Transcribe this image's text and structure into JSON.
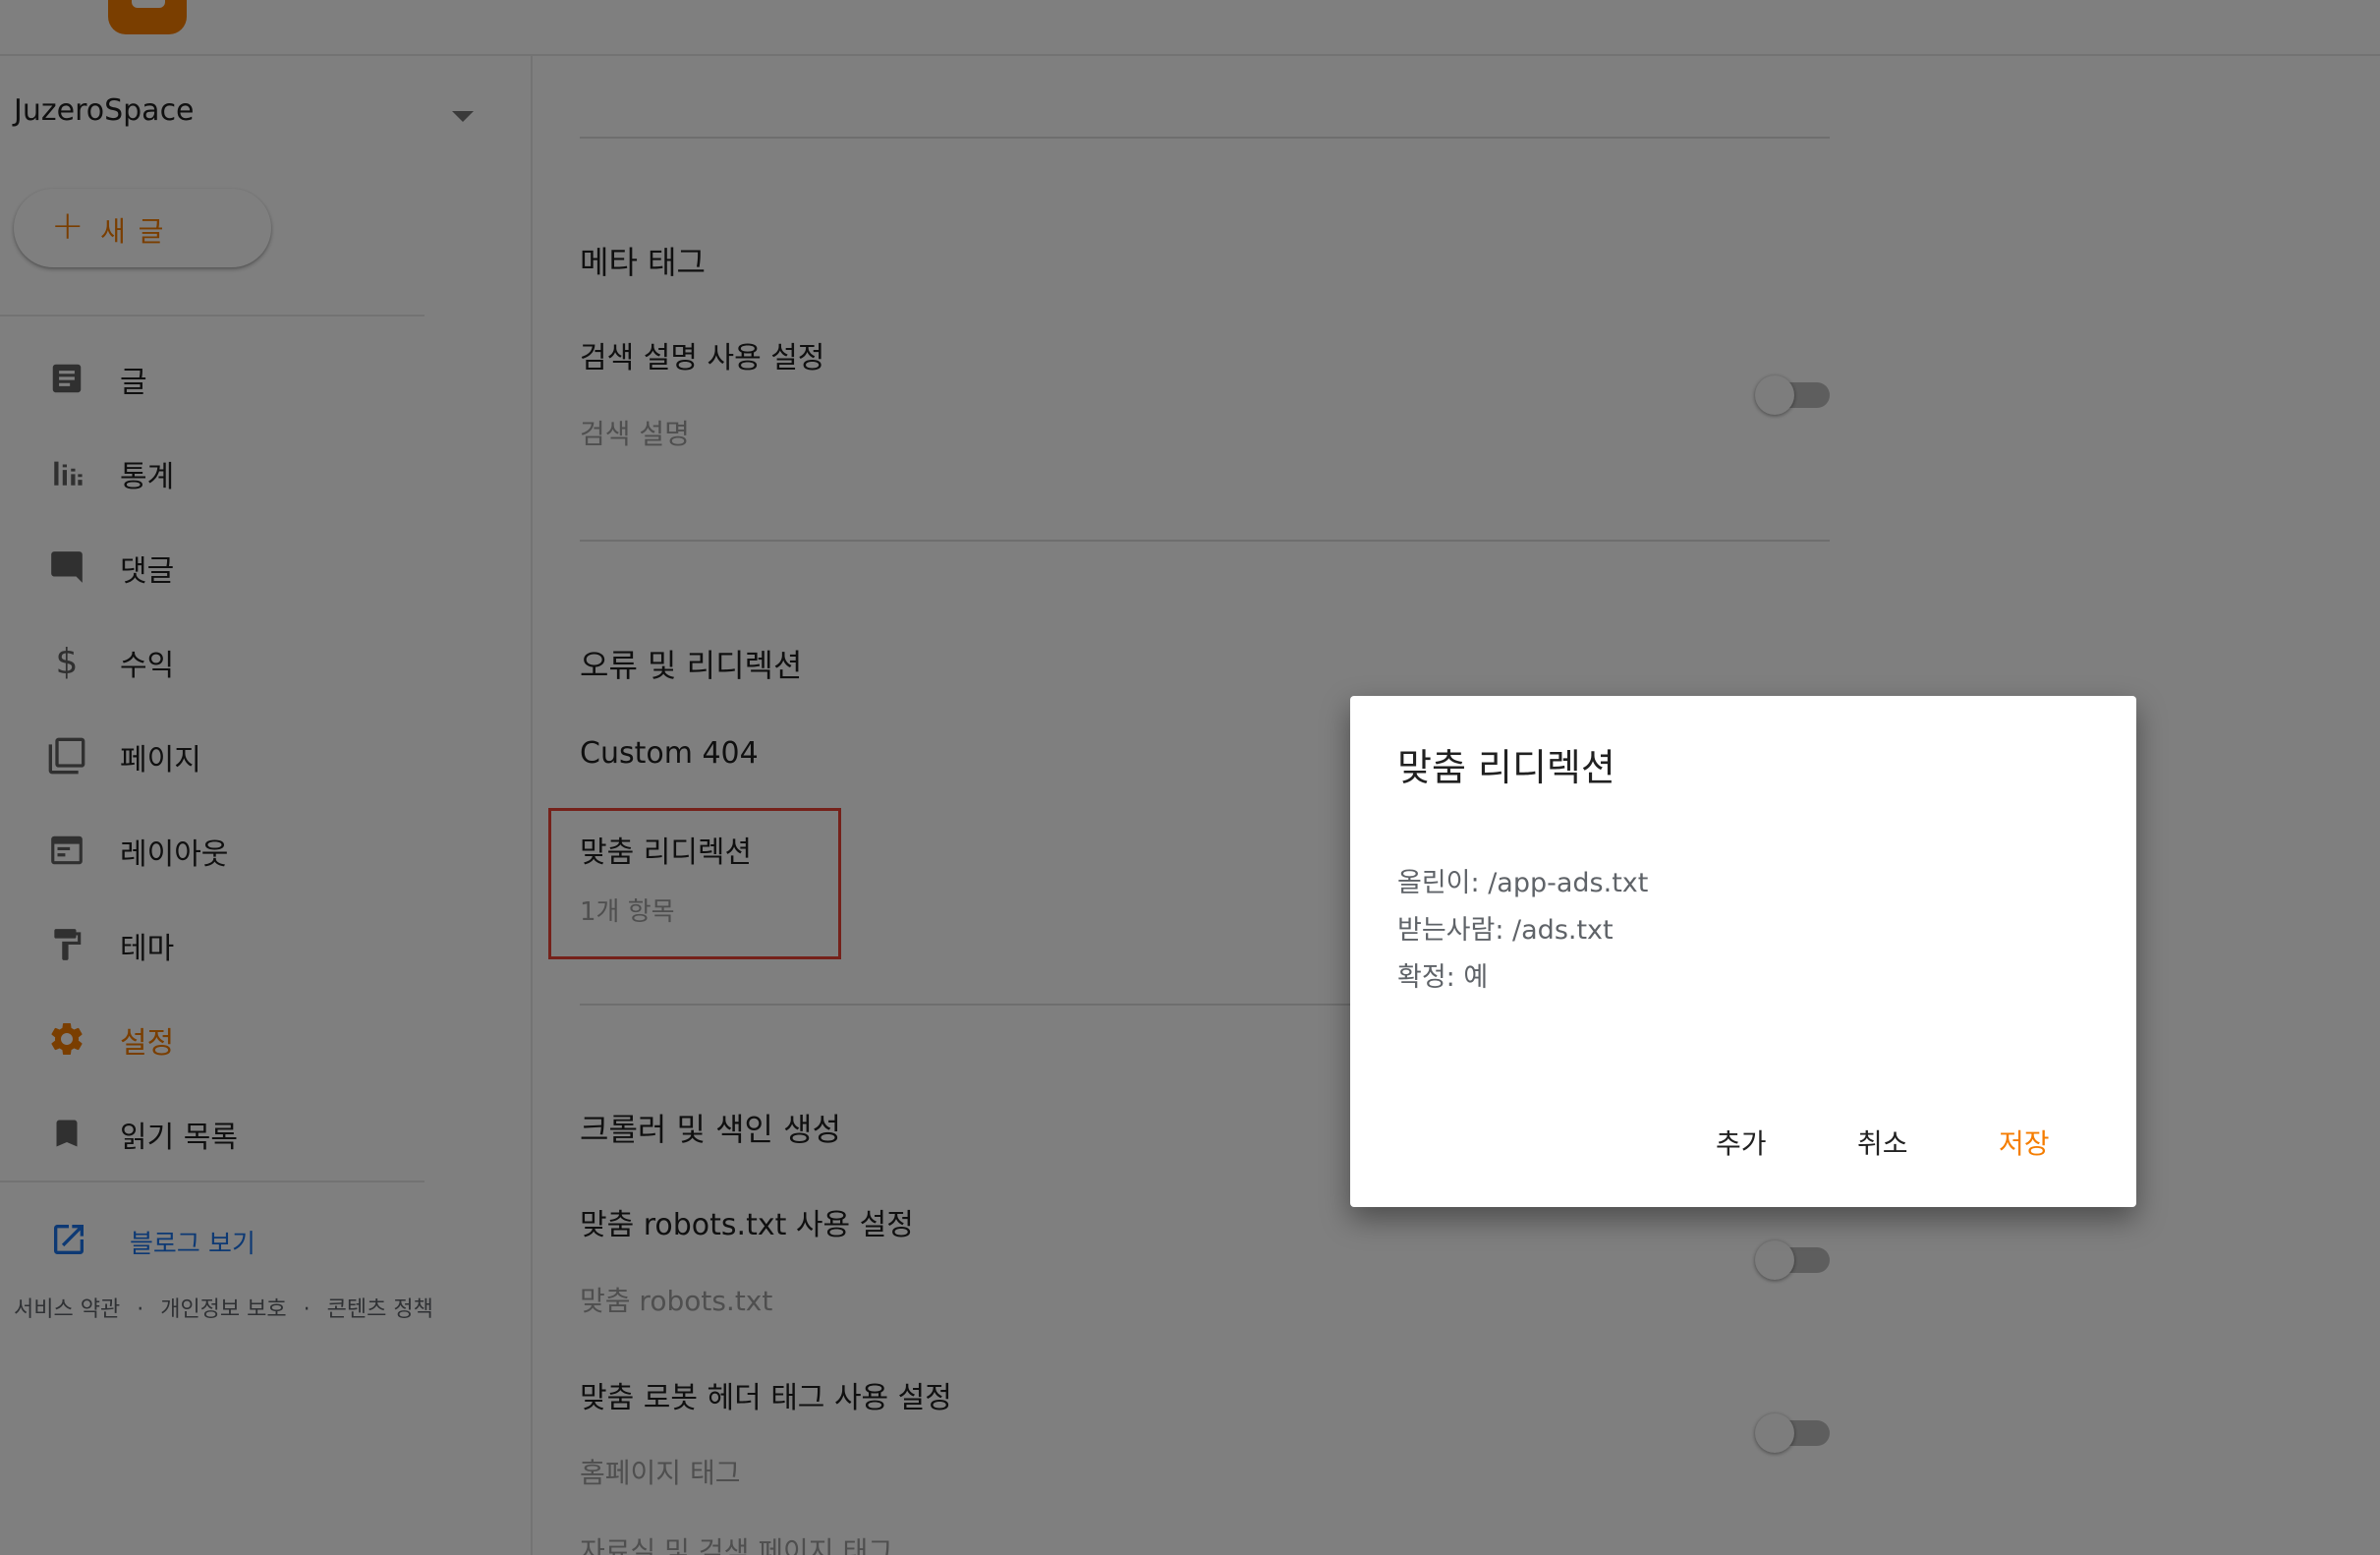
{
  "sidebar": {
    "blog_name": "JuzeroSpace",
    "new_post_label": "새 글",
    "items": [
      {
        "label": "글",
        "icon": "posts-icon"
      },
      {
        "label": "통계",
        "icon": "stats-icon"
      },
      {
        "label": "댓글",
        "icon": "comments-icon"
      },
      {
        "label": "수익",
        "icon": "earnings-icon"
      },
      {
        "label": "페이지",
        "icon": "pages-icon"
      },
      {
        "label": "레이아웃",
        "icon": "layout-icon"
      },
      {
        "label": "테마",
        "icon": "theme-icon"
      },
      {
        "label": "설정",
        "icon": "settings-icon",
        "active": true
      },
      {
        "label": "읽기 목록",
        "icon": "reading-list-icon"
      }
    ],
    "view_blog_label": "블로그 보기",
    "footer": {
      "terms": "서비스 약관",
      "privacy": "개인정보 보호",
      "content_policy": "콘텐츠 정책",
      "separator": "·"
    }
  },
  "main": {
    "meta_tags": {
      "title": "메타 태그",
      "search_description_toggle_label": "검색 설명 사용 설정",
      "search_description_label": "검색 설명"
    },
    "errors_redirects": {
      "title": "오류 및 리디렉션",
      "custom_404_label": "Custom 404",
      "custom_redirects_label": "맞춤 리디렉션",
      "custom_redirects_count": "1개 항목"
    },
    "crawlers_indexing": {
      "title": "크롤러 및 색인 생성",
      "custom_robots_toggle_label": "맞춤 robots.txt 사용 설정",
      "custom_robots_label": "맞춤 robots.txt",
      "custom_robot_header_toggle_label": "맞춤 로봇 헤더 태그 사용 설정",
      "homepage_tags_label": "홈페이지 태그",
      "archive_search_tags_label": "자료실 및 검색 페이지 태그"
    }
  },
  "dialog": {
    "title": "맞춤 리디렉션",
    "from_line": "올린이: /app-ads.txt",
    "to_line": "받는사람: /ads.txt",
    "permanent_line": "확정: 예",
    "add_label": "추가",
    "cancel_label": "취소",
    "save_label": "저장"
  },
  "colors": {
    "accent": "#f57d00",
    "link": "#1a73e8",
    "highlight": "#ea4335"
  }
}
